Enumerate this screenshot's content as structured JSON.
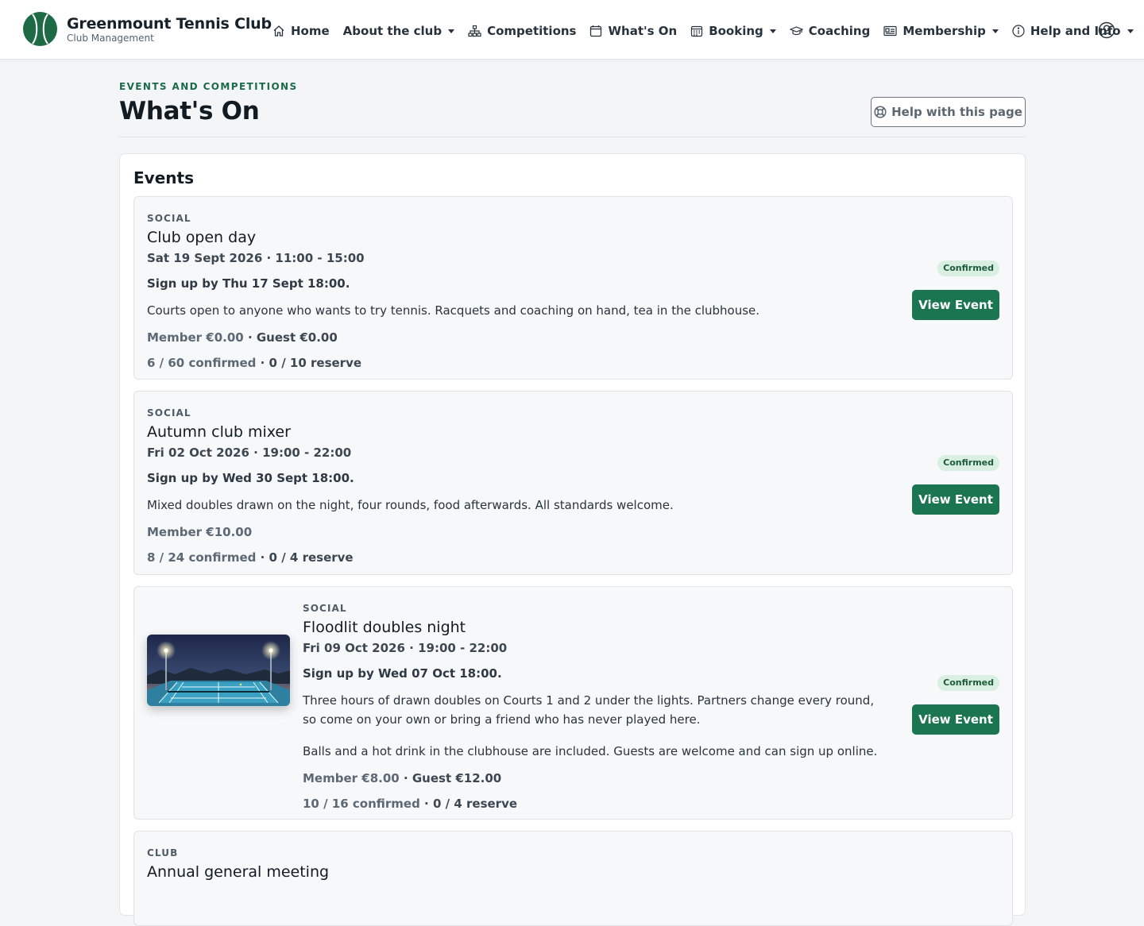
{
  "brand": {
    "name": "Greenmount Tennis Club",
    "subtitle": "Club Management"
  },
  "nav": [
    {
      "label": "Home",
      "icon": "home-icon"
    },
    {
      "label": "About the club",
      "icon": null,
      "dropdown": true
    },
    {
      "label": "Competitions",
      "icon": "sitemap-icon"
    },
    {
      "label": "What's On",
      "icon": "calendar-icon"
    },
    {
      "label": "Booking",
      "icon": "calendar-grid-icon",
      "dropdown": true
    },
    {
      "label": "Coaching",
      "icon": "mortarboard-icon"
    },
    {
      "label": "Membership",
      "icon": "id-card-icon",
      "dropdown": true
    },
    {
      "label": "Help and Info",
      "icon": "info-icon",
      "dropdown": true
    }
  ],
  "header": {
    "eyebrow": "EVENTS AND COMPETITIONS",
    "title": "What's On",
    "help_button": "Help with this page"
  },
  "events_panel": {
    "title": "Events",
    "events": [
      {
        "category": "SOCIAL",
        "title": "Club open day",
        "when": "Sat 19 Sept 2026 · 11:00 - 15:00",
        "signup": "Sign up by Thu 17 Sept 18:00.",
        "description": [
          "Courts open to anyone who wants to try tennis. Racquets and coaching on hand, tea in the clubhouse."
        ],
        "price_member": "Member €0.00",
        "price_guest": "Guest €0.00",
        "confirmed": "6 / 60 confirmed",
        "reserve": "0 / 10 reserve",
        "status": "Confirmed",
        "button": "View Event"
      },
      {
        "category": "SOCIAL",
        "title": "Autumn club mixer",
        "when": "Fri 02 Oct 2026 · 19:00 - 22:00",
        "signup": "Sign up by Wed 30 Sept 18:00.",
        "description": [
          "Mixed doubles drawn on the night, four rounds, food afterwards. All standards welcome."
        ],
        "price_member": "Member €10.00",
        "price_guest": "",
        "confirmed": "8 / 24 confirmed",
        "reserve": "0 / 4 reserve",
        "status": "Confirmed",
        "button": "View Event"
      },
      {
        "category": "SOCIAL",
        "title": "Floodlit doubles night",
        "when": "Fri 09 Oct 2026 · 19:00 - 22:00",
        "signup": "Sign up by Wed 07 Oct 18:00.",
        "description": [
          "Three hours of drawn doubles on Courts 1 and 2 under the lights. Partners change every round, so come on your own or bring a friend who has never played here.",
          "Balls and a hot drink in the clubhouse are included. Guests are welcome and can sign up online."
        ],
        "price_member": "Member €8.00",
        "price_guest": "Guest €12.00",
        "confirmed": "10 / 16 confirmed",
        "reserve": "0 / 4 reserve",
        "status": "Confirmed",
        "button": "View Event",
        "image": "floodlit-court-thumbnail"
      },
      {
        "category": "CLUB",
        "title": "Annual general meeting"
      }
    ]
  },
  "colors": {
    "accent": "#1b7550",
    "eyebrow": "#1b6b4a",
    "badge_bg": "#d9efe2",
    "badge_text": "#1d5b3b"
  }
}
